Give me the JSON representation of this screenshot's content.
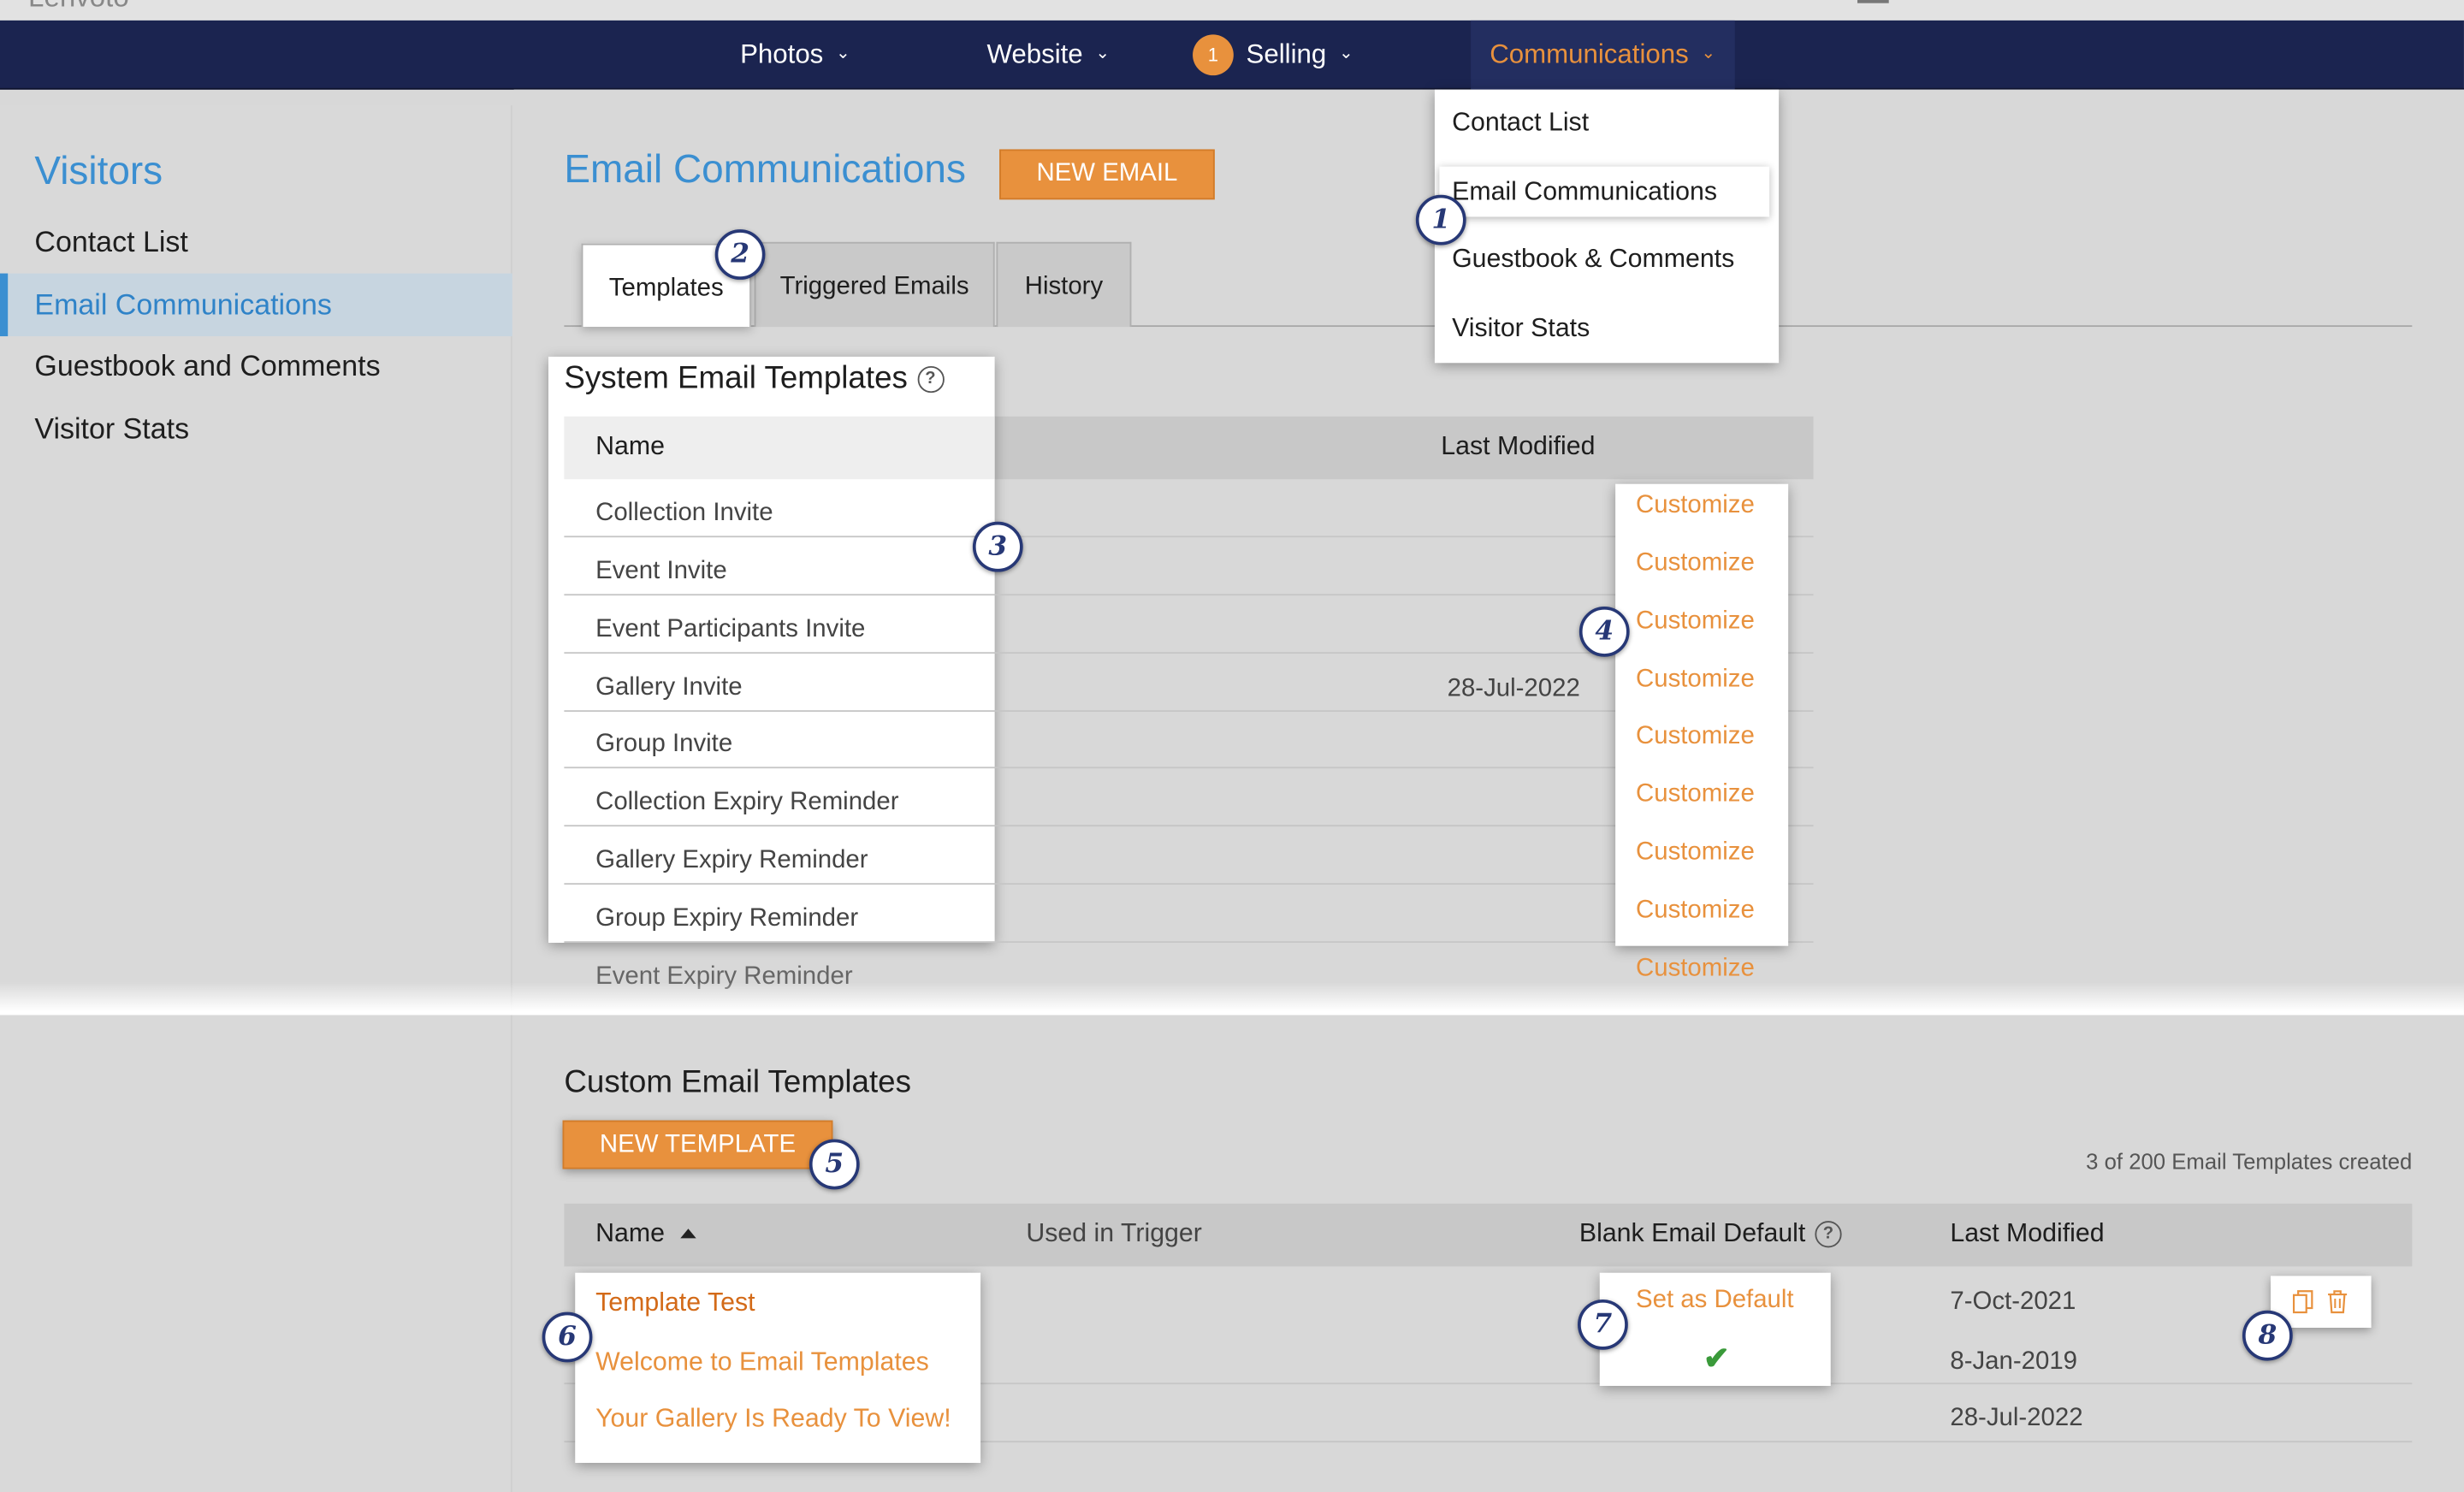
{
  "topbar": {
    "ghost_text": "Lenvoto"
  },
  "nav": {
    "items": [
      {
        "label": "Photos"
      },
      {
        "label": "Website"
      },
      {
        "label": "Selling",
        "badge": "1"
      },
      {
        "label": "Communications"
      }
    ],
    "dropdown": [
      "Contact List",
      "Email Communications",
      "Guestbook & Comments",
      "Visitor Stats"
    ]
  },
  "sidebar": {
    "title": "Visitors",
    "items": [
      {
        "label": "Contact List"
      },
      {
        "label": "Email Communications"
      },
      {
        "label": "Guestbook and Comments"
      },
      {
        "label": "Visitor Stats"
      }
    ]
  },
  "main": {
    "title": "Email Communications",
    "new_email": "NEW EMAIL",
    "tabs": [
      "Templates",
      "Triggered Emails",
      "History"
    ]
  },
  "system_templates": {
    "title": "System Email Templates",
    "help": "?",
    "col_name": "Name",
    "col_modified": "Last Modified",
    "customize_label": "Customize",
    "rows": [
      {
        "name": "Collection Invite",
        "modified": ""
      },
      {
        "name": "Event Invite",
        "modified": ""
      },
      {
        "name": "Event Participants Invite",
        "modified": ""
      },
      {
        "name": "Gallery Invite",
        "modified": "28-Jul-2022"
      },
      {
        "name": "Group Invite",
        "modified": ""
      },
      {
        "name": "Collection Expiry Reminder",
        "modified": ""
      },
      {
        "name": "Gallery Expiry Reminder",
        "modified": ""
      },
      {
        "name": "Group Expiry Reminder",
        "modified": ""
      },
      {
        "name": "Event Expiry Reminder",
        "modified": ""
      }
    ]
  },
  "custom_templates": {
    "title": "Custom Email Templates",
    "new_template": "NEW TEMPLATE",
    "count_text": "3 of 200 Email Templates created",
    "col_name": "Name",
    "col_trigger": "Used in Trigger",
    "col_default": "Blank Email Default",
    "col_modified": "Last Modified",
    "set_default": "Set as Default",
    "rows": [
      {
        "name": "Template Test",
        "modified": "7-Oct-2021"
      },
      {
        "name": "Welcome to Email Templates",
        "modified": "8-Jan-2019"
      },
      {
        "name": "Your Gallery Is Ready To View!",
        "modified": "28-Jul-2022"
      }
    ]
  },
  "callouts": [
    "1",
    "2",
    "3",
    "4",
    "5",
    "6",
    "7",
    "8"
  ],
  "colors": {
    "navy": "#1b2450",
    "orange": "#e8913d",
    "blue": "#3b8fd1",
    "callout": "#273876"
  },
  "icons": [
    "chevron-down-icon",
    "help-icon",
    "sort-up-icon",
    "checkmark-icon",
    "copy-icon",
    "trash-icon"
  ]
}
